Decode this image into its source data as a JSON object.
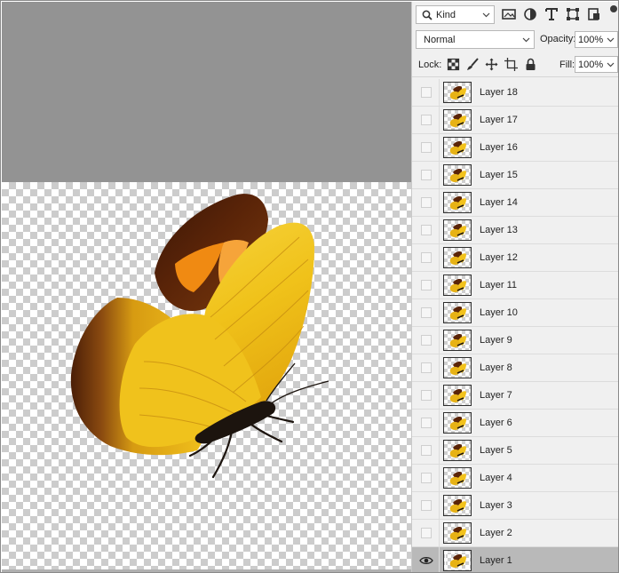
{
  "layers_panel": {
    "kind_filter": {
      "label": "Kind",
      "icon": "search-icon"
    },
    "filter_icons": [
      "image-filter-icon",
      "adjustment-filter-icon",
      "type-filter-icon",
      "shape-filter-icon",
      "smart-object-filter-icon"
    ],
    "blend_mode": "Normal",
    "opacity_label": "Opacity:",
    "opacity_value": "100%",
    "lock_label": "Lock:",
    "lock_icons": [
      "lock-transparency-icon",
      "lock-image-pixels-icon",
      "lock-position-icon",
      "lock-artboard-icon",
      "lock-all-icon"
    ],
    "fill_label": "Fill:",
    "fill_value": "100%",
    "layers": [
      {
        "name": "Layer 18",
        "visible": false,
        "selected": false
      },
      {
        "name": "Layer 17",
        "visible": false,
        "selected": false
      },
      {
        "name": "Layer 16",
        "visible": false,
        "selected": false
      },
      {
        "name": "Layer 15",
        "visible": false,
        "selected": false
      },
      {
        "name": "Layer 14",
        "visible": false,
        "selected": false
      },
      {
        "name": "Layer 13",
        "visible": false,
        "selected": false
      },
      {
        "name": "Layer 12",
        "visible": false,
        "selected": false
      },
      {
        "name": "Layer 11",
        "visible": false,
        "selected": false
      },
      {
        "name": "Layer 10",
        "visible": false,
        "selected": false
      },
      {
        "name": "Layer 9",
        "visible": false,
        "selected": false
      },
      {
        "name": "Layer 8",
        "visible": false,
        "selected": false
      },
      {
        "name": "Layer 7",
        "visible": false,
        "selected": false
      },
      {
        "name": "Layer 6",
        "visible": false,
        "selected": false
      },
      {
        "name": "Layer 5",
        "visible": false,
        "selected": false
      },
      {
        "name": "Layer 4",
        "visible": false,
        "selected": false
      },
      {
        "name": "Layer 3",
        "visible": false,
        "selected": false
      },
      {
        "name": "Layer 2",
        "visible": false,
        "selected": false
      },
      {
        "name": "Layer 1",
        "visible": true,
        "selected": true
      }
    ]
  },
  "canvas": {
    "pasteboard_color": "#939393",
    "transparency_checker": [
      "#ffffff",
      "#cccccc"
    ],
    "content": "butterfly-image"
  },
  "colors": {
    "panel_bg": "#f0f0f0",
    "selected_row": "#b9b9b9"
  }
}
